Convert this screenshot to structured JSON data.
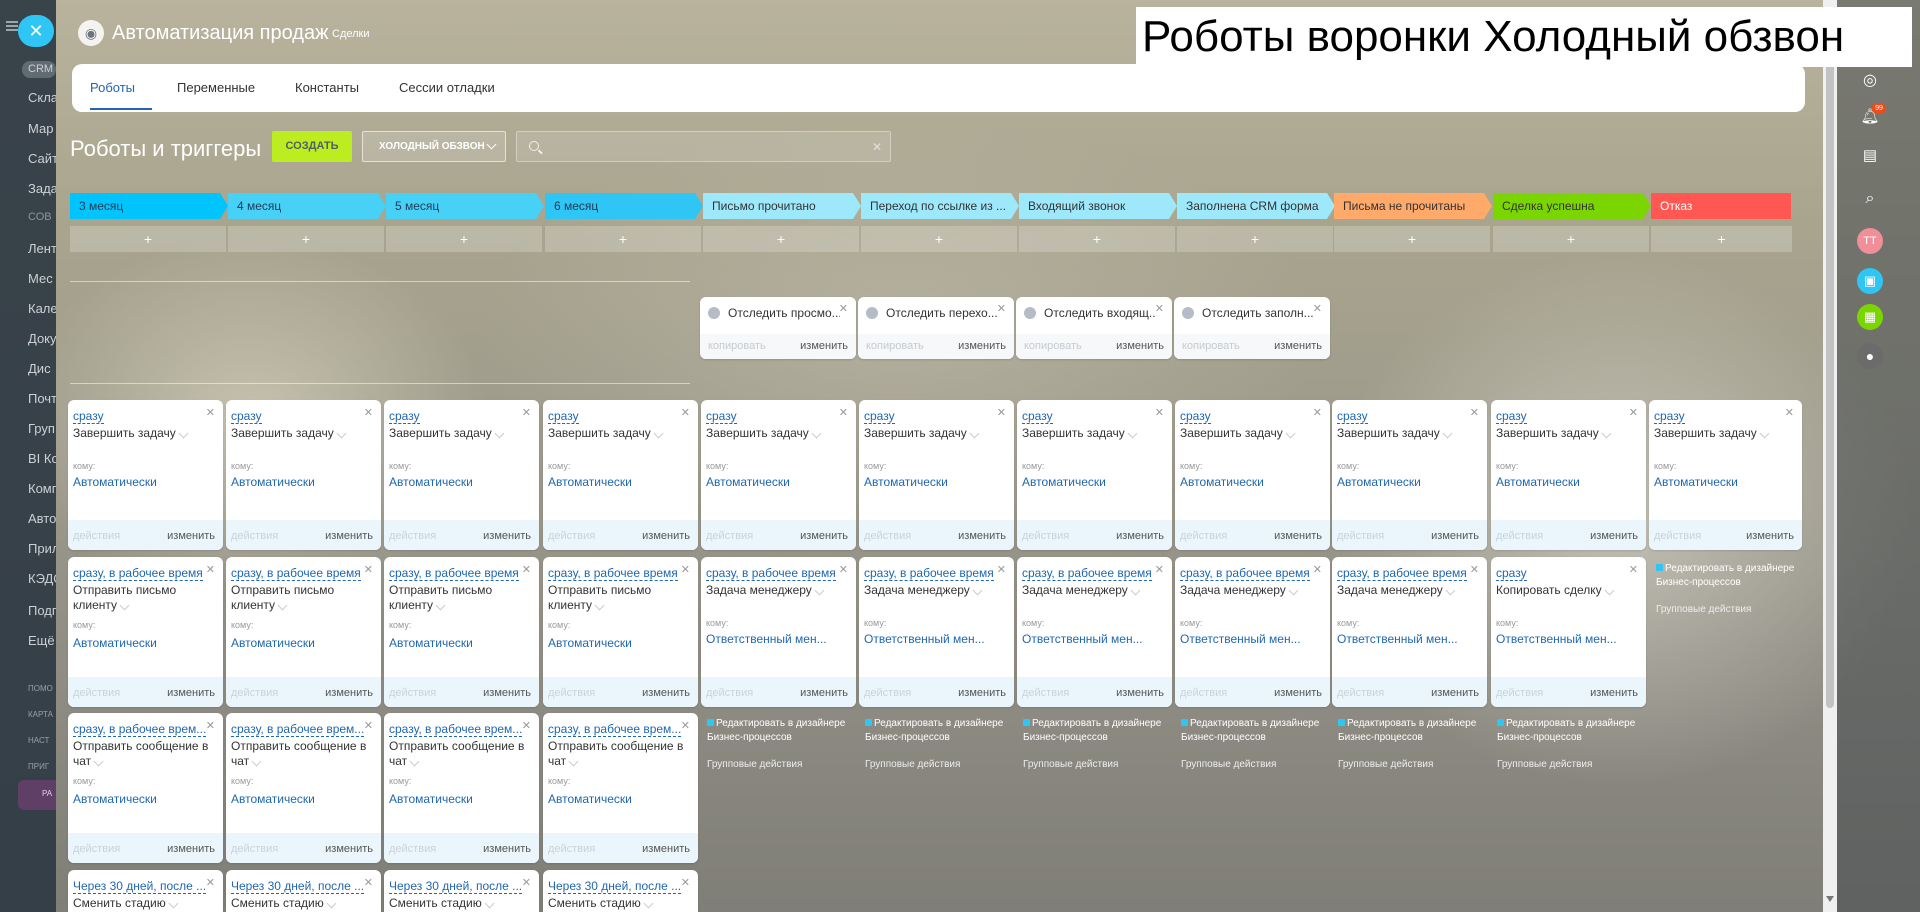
{
  "overlay_caption": "Роботы воронки Холодный обзвон",
  "left_nav": {
    "crm": "CRM",
    "items": [
      "Скла",
      "Мар",
      "Сайт",
      "Зада",
      "СОВ",
      "Лент",
      "Мес",
      "Кале",
      "Доку",
      "Дис",
      "Почт",
      "Груп",
      "BI Ко",
      "Комп",
      "Авто",
      "Прил",
      "КЭДО",
      "Подп",
      "Ещё"
    ],
    "bottom": [
      "ПОМО",
      "КАРТА",
      "НАСТ",
      "ПРИГ"
    ],
    "footer_label": "РА"
  },
  "header": {
    "title": "Автоматизация продаж",
    "subtitle": "Сделки"
  },
  "tabs": [
    "Роботы",
    "Переменные",
    "Константы",
    "Сессии отладки"
  ],
  "toolbar": {
    "page_title": "Роботы и триггеры",
    "create_label": "СОЗДАТЬ",
    "funnel_value": "ХОЛОДНЫЙ ОБЗВОН",
    "search_placeholder": ""
  },
  "right_bar": {
    "badge_count": "99",
    "avatar_initials": "TT"
  },
  "stages": [
    {
      "label": "3 месяц",
      "color": "#00c4fb"
    },
    {
      "label": "4 месяц",
      "color": "#47d1f7"
    },
    {
      "label": "5 месяц",
      "color": "#47d1f7"
    },
    {
      "label": "6 месяц",
      "color": "#2fc6f6"
    },
    {
      "label": "Письмо прочитано",
      "color": "#9ee8fc"
    },
    {
      "label": "Переход по ссылке из ...",
      "color": "#9ee8fc"
    },
    {
      "label": "Входящий звонок",
      "color": "#9ee8fc"
    },
    {
      "label": "Заполнена CRM форма",
      "color": "#9ee8fc"
    },
    {
      "label": "Письма не прочитаны",
      "color": "#ffa96b"
    },
    {
      "label": "Сделка успешна",
      "color": "#7bd500"
    },
    {
      "label": "Отказ",
      "color": "#ff5752"
    }
  ],
  "add_symbol": "+",
  "triggers": [
    {
      "title": "Отследить просмо...",
      "copy": "копировать",
      "edit": "изменить"
    },
    {
      "title": "Отследить перехо...",
      "copy": "копировать",
      "edit": "изменить"
    },
    {
      "title": "Отследить входящ...",
      "copy": "копировать",
      "edit": "изменить"
    },
    {
      "title": "Отследить заполн...",
      "copy": "копировать",
      "edit": "изменить"
    }
  ],
  "robot_row1": {
    "delay": "сразу",
    "name": "Завершить задачу",
    "who_label": "кому:",
    "who": "Автоматически",
    "actions": "действия",
    "edit": "изменить"
  },
  "robot_row2": [
    {
      "delay": "сразу, в рабочее время",
      "name": "Отправить письмо клиенту",
      "who": "Автоматически"
    },
    {
      "delay": "сразу, в рабочее время",
      "name": "Отправить письмо клиенту",
      "who": "Автоматически"
    },
    {
      "delay": "сразу, в рабочее время",
      "name": "Отправить письмо клиенту",
      "who": "Автоматически"
    },
    {
      "delay": "сразу, в рабочее время",
      "name": "Отправить письмо клиенту",
      "who": "Автоматически"
    },
    {
      "delay": "сразу, в рабочее время",
      "name": "Задача менеджеру",
      "who": "Ответственный мен..."
    },
    {
      "delay": "сразу, в рабочее время",
      "name": "Задача менеджеру",
      "who": "Ответственный мен..."
    },
    {
      "delay": "сразу, в рабочее время",
      "name": "Задача менеджеру",
      "who": "Ответственный мен..."
    },
    {
      "delay": "сразу, в рабочее время",
      "name": "Задача менеджеру",
      "who": "Ответственный мен..."
    },
    {
      "delay": "сразу, в рабочее время",
      "name": "Задача менеджеру",
      "who": "Ответственный мен..."
    },
    {
      "delay": "сразу",
      "name": "Копировать сделку",
      "who": "Ответственный мен..."
    }
  ],
  "robot_row3": {
    "delay": "сразу, в рабочее врем...",
    "name": "Отправить сообщение в чат",
    "who": "Автоматически"
  },
  "robot_row4": {
    "delay": "Через 30 дней, после ...",
    "name": "Сменить стадию"
  },
  "designer": {
    "line1": "Редактировать в дизайнере",
    "line2": "Бизнес-процессов",
    "group": "Групповые действия"
  }
}
